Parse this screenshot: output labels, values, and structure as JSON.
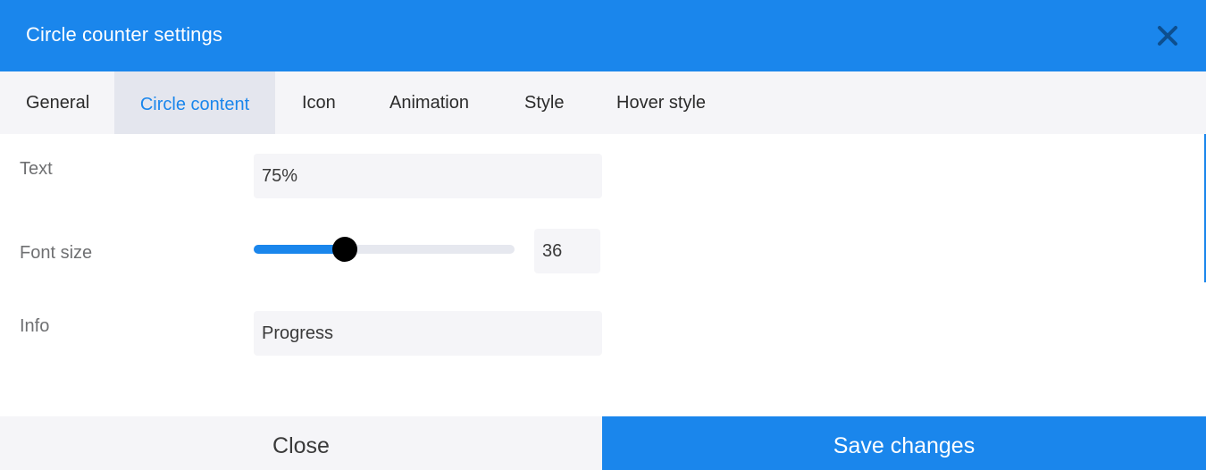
{
  "dialog": {
    "title": "Circle counter settings",
    "close_icon": "close-x-icon"
  },
  "tabs": [
    {
      "label": "General",
      "active": false
    },
    {
      "label": "Circle content",
      "active": true
    },
    {
      "label": "Icon",
      "active": false
    },
    {
      "label": "Animation",
      "active": false
    },
    {
      "label": "Style",
      "active": false
    },
    {
      "label": "Hover style",
      "active": false
    }
  ],
  "fields": {
    "text": {
      "label": "Text",
      "value": "75%"
    },
    "font_size": {
      "label": "Font size",
      "value": "36",
      "slider_fraction": 0.35
    },
    "info": {
      "label": "Info",
      "value": "Progress"
    }
  },
  "footer": {
    "close_label": "Close",
    "save_label": "Save changes"
  },
  "colors": {
    "accent": "#1a86ec",
    "tab_bar": "#f5f5f8",
    "active_tab": "#e4e6ee",
    "slider_thumb": "#000000"
  }
}
